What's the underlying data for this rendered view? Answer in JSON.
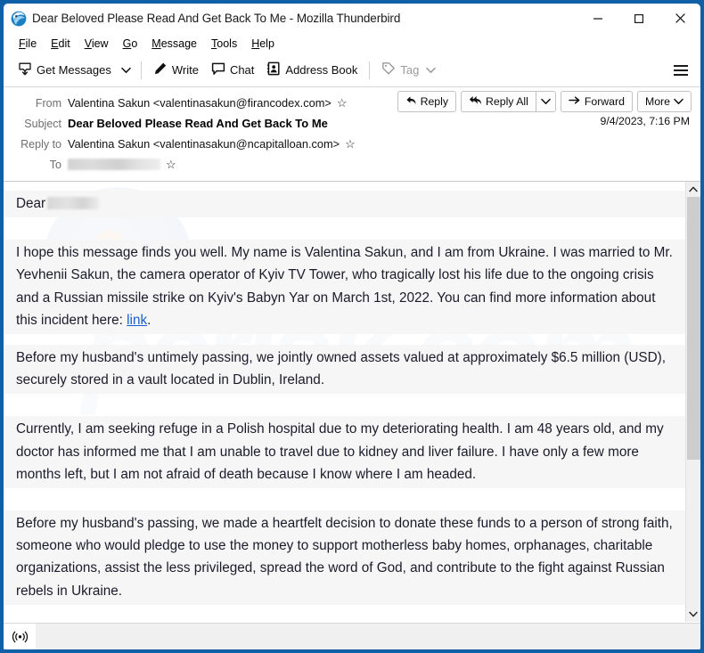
{
  "window": {
    "title": "Dear Beloved Please Read And Get Back To Me - Mozilla Thunderbird",
    "app_icon": "thunderbird-icon",
    "controls": {
      "minimize": "minimize-icon",
      "maximize": "maximize-icon",
      "close": "close-icon"
    },
    "accent_color": "#1060a8"
  },
  "menubar": {
    "items": [
      {
        "label": "File",
        "accel": "F"
      },
      {
        "label": "Edit",
        "accel": "E"
      },
      {
        "label": "View",
        "accel": "V"
      },
      {
        "label": "Go",
        "accel": "G"
      },
      {
        "label": "Message",
        "accel": "M"
      },
      {
        "label": "Tools",
        "accel": "T"
      },
      {
        "label": "Help",
        "accel": "H"
      }
    ]
  },
  "toolbar": {
    "get_messages": "Get Messages",
    "write": "Write",
    "chat": "Chat",
    "address_book": "Address Book",
    "tag": "Tag",
    "app_menu": "hamburger-menu-icon"
  },
  "message_header": {
    "from_label": "From",
    "from_value": "Valentina Sakun <valentinasakun@firancodex.com>",
    "subject_label": "Subject",
    "subject_value": "Dear Beloved Please Read And Get Back To Me",
    "reply_to_label": "Reply to",
    "reply_to_value": "Valentina Sakun <valentinasakun@ncapitalloan.com>",
    "to_label": "To",
    "to_value": "",
    "to_redacted": true,
    "date": "9/4/2023, 7:16 PM",
    "actions": {
      "reply": "Reply",
      "reply_all": "Reply All",
      "reply_all_more": "chevron-down-icon",
      "forward": "Forward",
      "more": "More"
    }
  },
  "body": {
    "greeting": "Dear",
    "greeting_redacted": true,
    "paragraphs": [
      "I hope this message finds you well. My name is Valentina Sakun, and I am from Ukraine. I was married to Mr. Yevhenii Sakun, the camera operator of Kyiv TV Tower, who tragically lost his life due to the ongoing crisis and a Russian missile strike on Kyiv's Babyn Yar on March 1st, 2022. You can find more information about this incident here: ",
      "Before my husband's untimely passing, we jointly owned assets valued at approximately $6.5 million (USD), securely stored in a vault located in Dublin, Ireland.",
      "Currently, I am seeking refuge in a Polish hospital due to my deteriorating health. I am 48 years old, and my doctor has informed me that I am unable to travel due to kidney and liver failure. I have only a few more months left, but I am not afraid of death because I know where I am headed.",
      "Before my husband's passing, we made a heartfelt decision to donate these funds to a person of strong faith, someone who would pledge to use the money to support motherless baby homes, orphanages, charitable organizations, assist the less privileged, spread the word of God, and contribute to the fight against Russian rebels in Ukraine."
    ],
    "link_text": "link",
    "link_trailing": ".",
    "link_color": "#1a5fd0",
    "watermark_text": "pcrisk.com"
  },
  "scrollbar": {
    "up_arrow": "chevron-up-icon",
    "down_arrow": "chevron-down-icon"
  },
  "statusbar": {
    "connection_icon": "online-status-icon",
    "text": ""
  }
}
